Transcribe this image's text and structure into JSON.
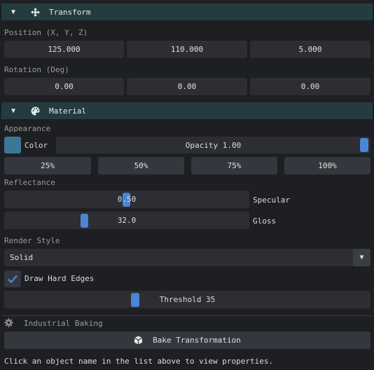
{
  "transform": {
    "title": "Transform",
    "position_label": "Position (X, Y, Z)",
    "position": [
      "125.000",
      "110.000",
      "5.000"
    ],
    "rotation_label": "Rotation (Deg)",
    "rotation": [
      "0.00",
      "0.00",
      "0.00"
    ]
  },
  "material": {
    "title": "Material",
    "appearance_label": "Appearance",
    "color_label": "Color",
    "color_value": "#3b7796",
    "opacity_text": "Opacity 1.00",
    "opacity": 1.0,
    "presets": [
      "25%",
      "50%",
      "75%",
      "100%"
    ],
    "reflectance_label": "Reflectance",
    "specular_value": "0.50",
    "specular_label": "Specular",
    "gloss_value": "32.0",
    "gloss_label": "Gloss",
    "render_style_label": "Render Style",
    "render_style_value": "Solid",
    "draw_hard_edges_label": "Draw Hard Edges",
    "draw_hard_edges_checked": true,
    "threshold_text": "Threshold 35"
  },
  "baking": {
    "title": "Industrial Baking",
    "bake_button": "Bake Transformation"
  },
  "footer_text": "Click an object name in the list above to view properties.",
  "colors": {
    "accent": "#4a86d6",
    "header_bg": "#243b40",
    "swatch": "#3b7796"
  }
}
